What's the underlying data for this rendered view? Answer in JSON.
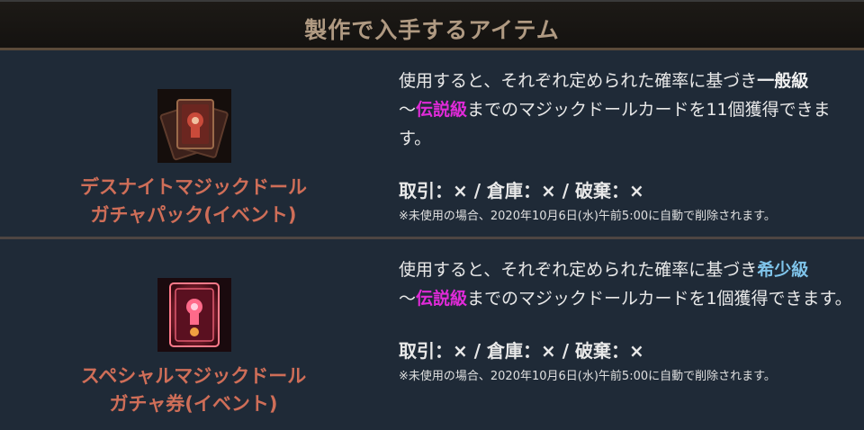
{
  "header": {
    "title": "製作で入手するアイテム"
  },
  "items": [
    {
      "name_line1": "デスナイトマジックドール",
      "name_line2": "ガチャパック(イベント)",
      "desc_part1": "使用すると、それぞれ定められた確率に基づき",
      "desc_grade_from": "一般級",
      "desc_part2": "～",
      "desc_grade_to": "伝説級",
      "desc_part3": "までのマジックドールカードを11個獲得できます。",
      "trade": "取引：× / 倉庫：× / 破棄：×",
      "note": "※未使用の場合、2020年10月6日(水)午前5:00に自動で削除されます。",
      "icon": "card-pack-icon"
    },
    {
      "name_line1": "スペシャルマジックドール",
      "name_line2": "ガチャ券(イベント)",
      "desc_part1": "使用すると、それぞれ定められた確率に基づき",
      "desc_grade_from": "希少級",
      "desc_part2": "～",
      "desc_grade_to": "伝説級",
      "desc_part3": "までのマジックドールカードを1個獲得できます。",
      "trade": "取引：× / 倉庫：× / 破棄：×",
      "note": "※未使用の場合、2020年10月6日(水)午前5:00に自動で削除されます。",
      "icon": "gacha-ticket-icon"
    }
  ],
  "colors": {
    "header_text": "#b09a82",
    "item_name": "#cf6e58",
    "grade_normal": "#f0f0f0",
    "grade_rare": "#7fc4ea",
    "grade_legend": "#e02ad8",
    "background": "#1f2a37"
  }
}
